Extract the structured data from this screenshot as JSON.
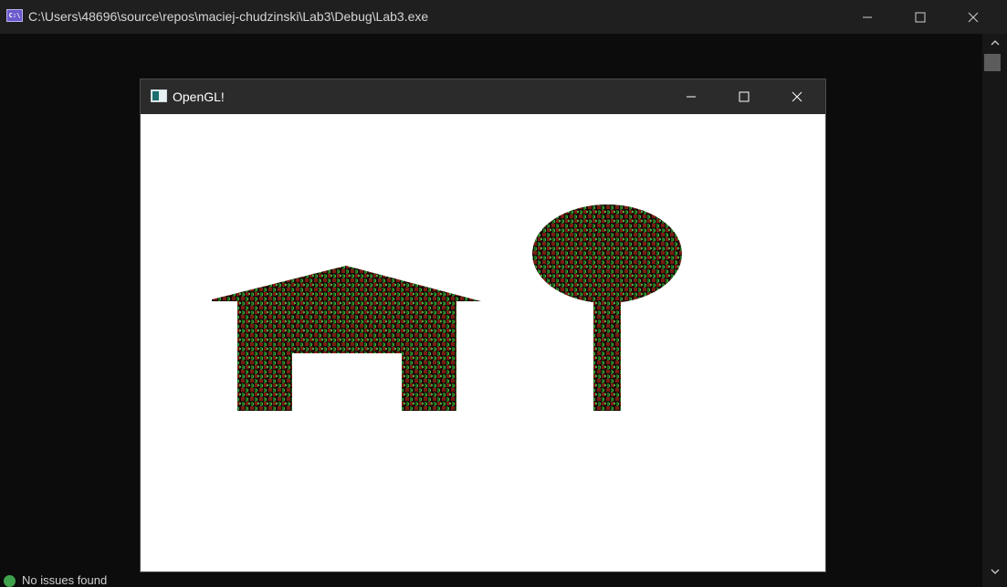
{
  "console": {
    "title": "C:\\Users\\48696\\source\\repos\\maciej-chudzinski\\Lab3\\Debug\\Lab3.exe",
    "icon_text": "C:\\",
    "icon": "console-app-icon",
    "controls": [
      "minimize-icon",
      "maximize-icon",
      "close-icon"
    ]
  },
  "status": {
    "text": "No issues found",
    "icon": "check-circle-icon"
  },
  "gl_window": {
    "title": "OpenGL!",
    "icon": "window-app-icon",
    "controls": [
      "minimize-icon",
      "maximize-icon",
      "close-icon"
    ]
  },
  "scene": {
    "texture_colors": [
      "#1a0808",
      "#7a1e12",
      "#1d6b1d",
      "#3fae3f"
    ],
    "objects": [
      "house",
      "tree"
    ]
  }
}
